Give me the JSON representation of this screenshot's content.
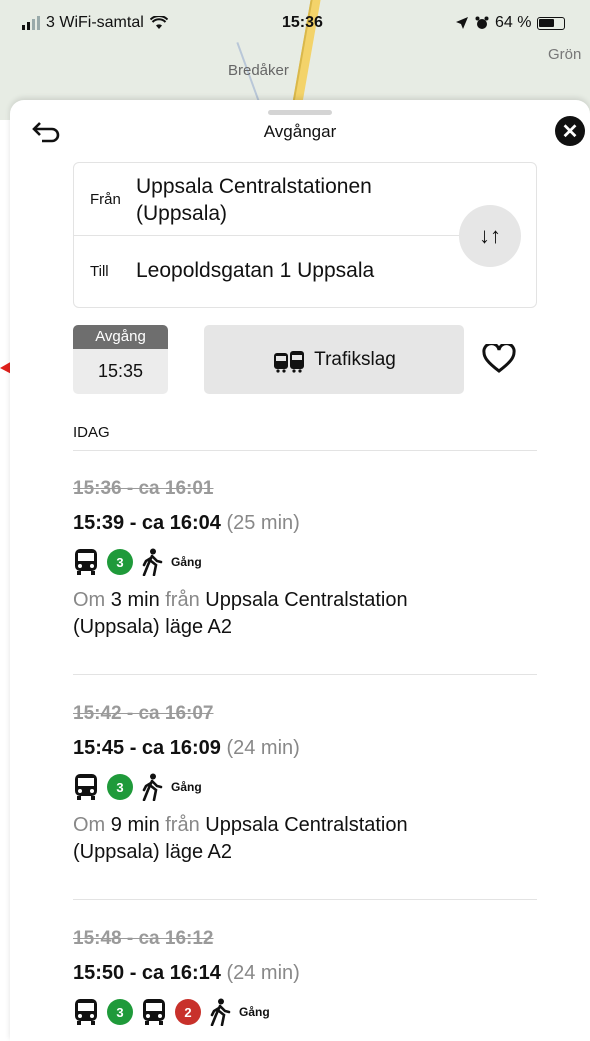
{
  "status": {
    "carrier": "3 WiFi-samtal",
    "time": "15:36",
    "battery": "64 %"
  },
  "map": {
    "place1": "Bredåker",
    "place2": "Grön"
  },
  "header": {
    "title": "Avgångar"
  },
  "route": {
    "from_label": "Från",
    "from_value": "Uppsala Centralstationen (Uppsala)",
    "to_label": "Till",
    "to_value": "Leopoldsgatan 1 Uppsala"
  },
  "controls": {
    "depart_label": "Avgång",
    "depart_time": "15:35",
    "mode_label": "Trafikslag"
  },
  "day_label": "IDAG",
  "trips": [
    {
      "old_time": "15:36 - ca 16:01",
      "new_time": "15:39 - ca 16:04",
      "duration": "(25 min)",
      "line": "3",
      "walk_label": "Gång",
      "info_om": "Om",
      "info_min": "3 min",
      "info_fran": "från",
      "info_stop": "Uppsala Centralstation",
      "info_rest": "(Uppsala) läge A2"
    },
    {
      "old_time": "15:42 - ca 16:07",
      "new_time": "15:45 - ca 16:09",
      "duration": "(24 min)",
      "line": "3",
      "walk_label": "Gång",
      "info_om": "Om",
      "info_min": "9 min",
      "info_fran": "från",
      "info_stop": "Uppsala Centralstation",
      "info_rest": "(Uppsala) läge A2"
    },
    {
      "old_time": "15:48 - ca 16:12",
      "new_time": "15:50 - ca 16:14",
      "duration": "(24 min)",
      "line": "3",
      "line2": "2",
      "walk_label": "Gång"
    }
  ],
  "colors": {
    "line3": "#1f9a3a",
    "line2": "#c8312b"
  }
}
